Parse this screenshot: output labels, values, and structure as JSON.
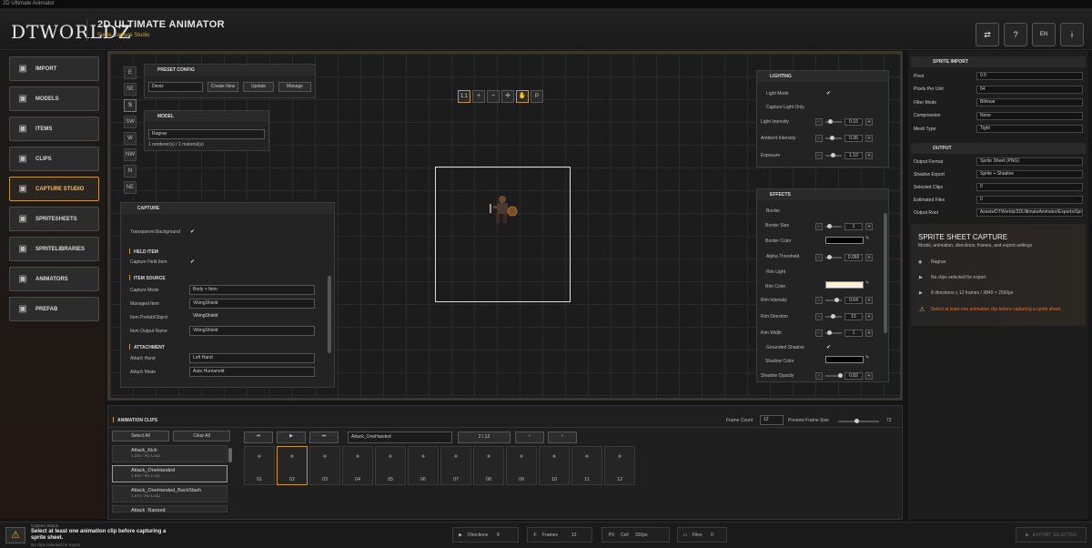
{
  "window": {
    "title": "2D Ultimate Animator"
  },
  "header": {
    "logo": "DTWORLDZ",
    "title": "2D ULTIMATE ANIMATOR",
    "subtitle": "Sprite Capture Studio",
    "lang": "EN"
  },
  "sidebar": {
    "items": [
      {
        "label": "IMPORT",
        "icon": "import-icon"
      },
      {
        "label": "MODELS",
        "icon": "models-icon"
      },
      {
        "label": "ITEMS",
        "icon": "items-icon"
      },
      {
        "label": "CLIPS",
        "icon": "clips-icon"
      },
      {
        "label": "CAPTURE STUDIO",
        "icon": "camera-icon",
        "active": true
      },
      {
        "label": "SPRITESHEETS",
        "icon": "spritesheet-icon"
      },
      {
        "label": "SPRITELIBRARIES",
        "icon": "library-icon"
      },
      {
        "label": "ANIMATORS",
        "icon": "animator-icon"
      },
      {
        "label": "PREFAB",
        "icon": "prefab-icon"
      }
    ]
  },
  "directions": [
    "E",
    "SE",
    "S",
    "SW",
    "W",
    "NW",
    "N",
    "NE"
  ],
  "preset": {
    "title": "PRESET CONFIG",
    "value": "Deniz",
    "create": "Create New",
    "update": "Update",
    "manage": "Manage"
  },
  "model": {
    "title": "MODEL",
    "value": "Ragnar",
    "info": "1 renderer(s) / 1 material(s)"
  },
  "toolbar": {
    "one": "1:1",
    "p": "P"
  },
  "capture": {
    "title": "CAPTURE",
    "transparent": "Transparent Background",
    "held_section": "HELD ITEM",
    "held_item": "Capture Held Item",
    "source_section": "ITEM SOURCE",
    "mode_label": "Capture Mode",
    "mode": "Body + Item",
    "managed_label": "Managed Item",
    "managed": "VikingShield",
    "prefab_label": "Item Prefab/Object",
    "prefab": "VikingShield",
    "output_label": "Item Output Name",
    "output": "VikingShield",
    "attach_section": "ATTACHMENT",
    "hand_label": "Attach Hand",
    "hand": "Left Hand",
    "amode_label": "Attach Mode",
    "amode": "Auto Humanoid"
  },
  "lighting": {
    "title": "LIGHTING",
    "light_mode": "Light Mode",
    "capture_only": "Capture Light Only",
    "intensity_label": "Light Intensity",
    "intensity": "0.15",
    "ambient_label": "Ambient Intensity",
    "ambient": "0.35",
    "exposure_label": "Exposure",
    "exposure": "1.10"
  },
  "effects": {
    "title": "EFFECTS",
    "border": "Border",
    "border_size_label": "Border Size",
    "border_size": "1",
    "border_color": "Border Color",
    "alpha_label": "Alpha Threshold",
    "alpha": "0.050",
    "rim_light": "Rim Light",
    "rim_color": "Rim Color",
    "rim_intensity_label": "Rim Intensity",
    "rim_intensity": "0.64",
    "rim_dir_label": "Rim Direction",
    "rim_dir": "15",
    "rim_width_label": "Rim Width",
    "rim_width": "1",
    "grounded": "Grounded Shadow",
    "shadow_color": "Shadow Color",
    "shadow_op_label": "Shadow Opacity",
    "shadow_op": "0.82"
  },
  "sprite_import": {
    "title": "SPRITE IMPORT",
    "rows": [
      {
        "k": "Pivot",
        "v": "0.5"
      },
      {
        "k": "Pixels Per Unit",
        "v": "64"
      },
      {
        "k": "Filter Mode",
        "v": "Bilinear"
      },
      {
        "k": "Compression",
        "v": "None"
      },
      {
        "k": "Mesh Type",
        "v": "Tight"
      }
    ]
  },
  "output": {
    "title": "OUTPUT",
    "rows": [
      {
        "k": "Output Format",
        "v": "Sprite Sheet (PNG)"
      },
      {
        "k": "Shadow Export",
        "v": "Sprite + Shadow"
      },
      {
        "k": "Selected Clips",
        "v": "0"
      },
      {
        "k": "Estimated Files",
        "v": "0"
      },
      {
        "k": "Output Root",
        "v": "Assets/DTWorldz/2DUltimateAnimator/Exports/Spr"
      }
    ]
  },
  "summary": {
    "title": "SPRITE SHEET CAPTURE",
    "desc": "Model, animation, directions, frames, and export settings",
    "model": "Ragnar",
    "clips": "No clips selected for export",
    "dims": "8 directions x 12 frames / 3840 × 2560px",
    "warning": "Select at least one animation clip before capturing a sprite sheet."
  },
  "clips": {
    "title": "ANIMATION CLIPS",
    "frame_count_label": "Frame Count",
    "frame_count": "12",
    "preview_label": "Preview Frame Size",
    "preview_size": "72",
    "select_all": "Select All",
    "clear_all": "Clear All",
    "current": "Attack_OneHanded",
    "counter": "2 / 12",
    "items": [
      {
        "name": "Attack_Kick",
        "dur": "1.33s / No Loop"
      },
      {
        "name": "Attack_OneHanded",
        "dur": "1.93s / No Loop",
        "sel": true
      },
      {
        "name": "Attack_OneHanded_BackSlash",
        "dur": "1.67s / No Loop"
      },
      {
        "name": "Attack_Ranged",
        "dur": ""
      }
    ],
    "frames": [
      "01",
      "02",
      "03",
      "04",
      "05",
      "06",
      "07",
      "08",
      "09",
      "10",
      "11",
      "12"
    ]
  },
  "status": {
    "label": "Capture Status",
    "message": "Select at least one animation clip before capturing a sprite sheet.",
    "sub": "No clips selected for export",
    "directions_label": "Directions",
    "directions": "8",
    "frames_label": "Frames",
    "frames": "12",
    "cell_label": "Cell",
    "cell": "320px",
    "files_label": "Files",
    "files": "0",
    "export": "EXPORT SELECTED"
  }
}
